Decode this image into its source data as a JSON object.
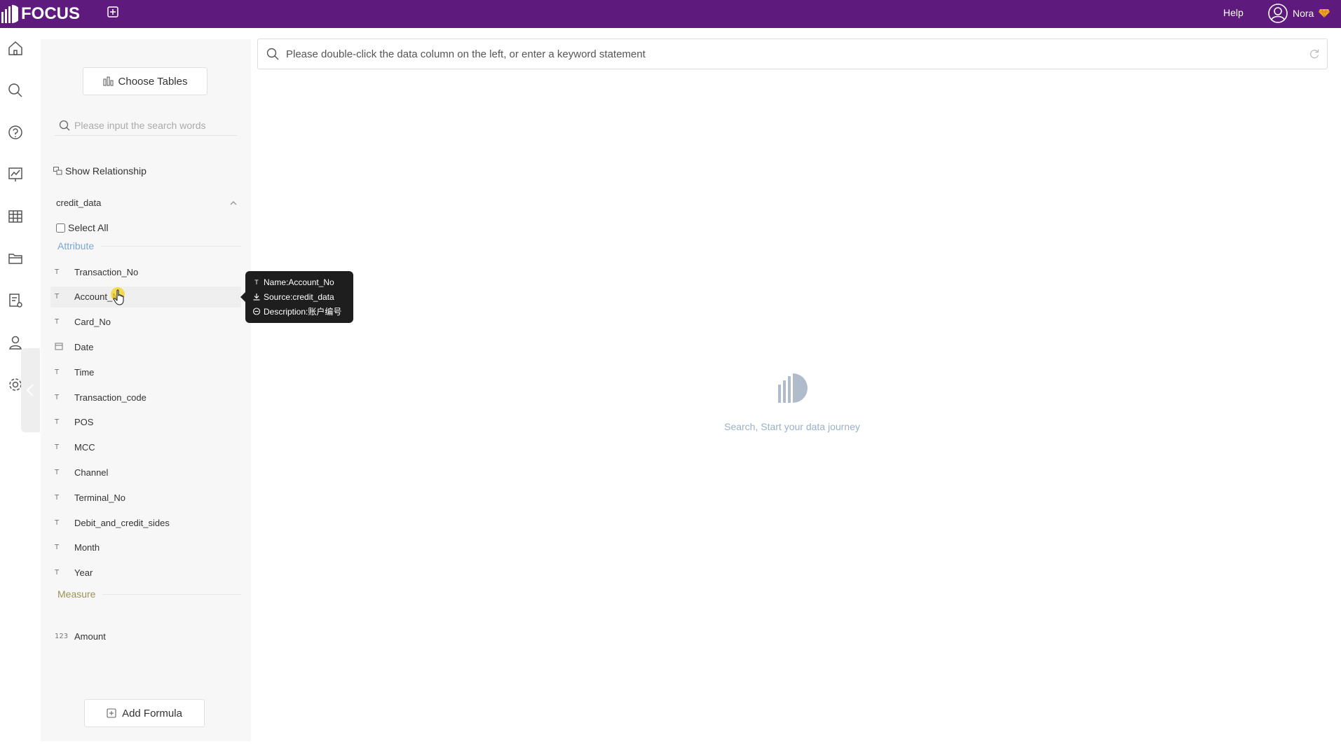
{
  "app": {
    "name": "FOCUS"
  },
  "header": {
    "help_label": "Help",
    "user_name": "Nora"
  },
  "panel": {
    "choose_tables_label": "Choose Tables",
    "search_placeholder": "Please input the search words",
    "show_relationship_label": "Show Relationship",
    "table_name": "credit_data",
    "select_all_label": "Select All",
    "attribute_label": "Attribute",
    "measure_label": "Measure",
    "attributes": [
      {
        "type": "T",
        "name": "Transaction_No"
      },
      {
        "type": "T",
        "name": "Account_No"
      },
      {
        "type": "T",
        "name": "Card_No"
      },
      {
        "type": "date",
        "name": "Date"
      },
      {
        "type": "T",
        "name": "Time"
      },
      {
        "type": "T",
        "name": "Transaction_code"
      },
      {
        "type": "T",
        "name": "POS"
      },
      {
        "type": "T",
        "name": "MCC"
      },
      {
        "type": "T",
        "name": "Channel"
      },
      {
        "type": "T",
        "name": "Terminal_No"
      },
      {
        "type": "T",
        "name": "Debit_and_credit_sides"
      },
      {
        "type": "T",
        "name": "Month"
      },
      {
        "type": "T",
        "name": "Year"
      }
    ],
    "measures": [
      {
        "type": "123",
        "name": "Amount"
      }
    ],
    "add_formula_label": "Add Formula"
  },
  "tooltip": {
    "name": "Name:Account_No",
    "source": "Source:credit_data",
    "description": "Description:账户编号"
  },
  "main": {
    "search_placeholder": "Please double-click the data column on the left, or enter a keyword statement",
    "empty_text": "Search, Start your data journey"
  },
  "colors": {
    "topbar": "#5e1a7c",
    "attribute": "#7aa7d6",
    "measure": "#9a9257",
    "empty_text": "#9ab0c7"
  }
}
